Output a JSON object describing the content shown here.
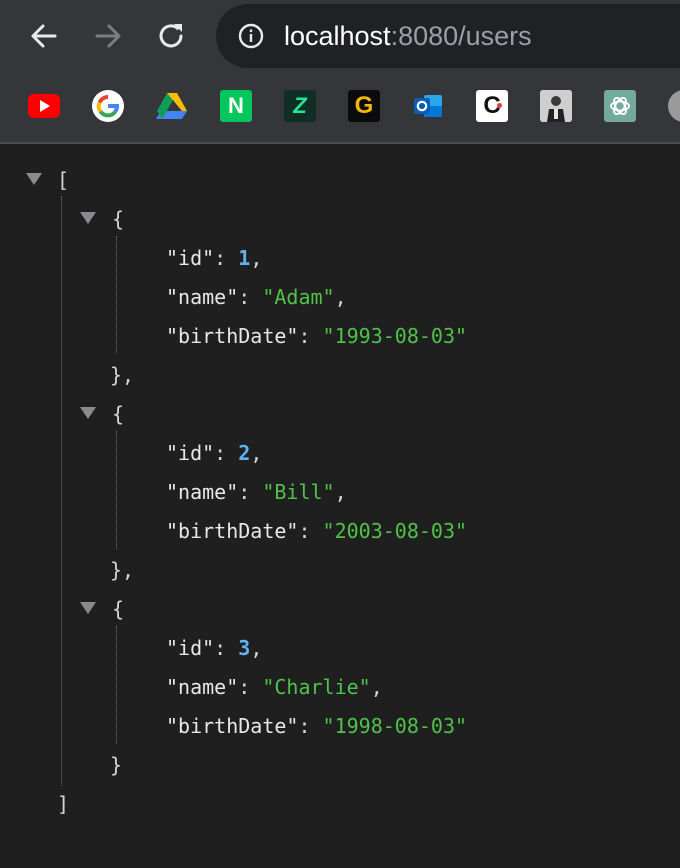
{
  "browser": {
    "address_bar": {
      "host": "localhost",
      "rest": ":8080/users"
    },
    "bookmarks": [
      {
        "icon": "youtube-icon"
      },
      {
        "icon": "google-icon"
      },
      {
        "icon": "google-drive-icon"
      },
      {
        "icon": "naver-icon",
        "letter": "N"
      },
      {
        "icon": "app-z-icon",
        "letter": "Z"
      },
      {
        "icon": "app-g-icon",
        "letter": "G"
      },
      {
        "icon": "outlook-icon",
        "letter": "O"
      },
      {
        "icon": "app-c-icon",
        "letter": "C"
      },
      {
        "icon": "profile-photo-icon"
      },
      {
        "icon": "chatgpt-icon"
      }
    ]
  },
  "json_viewer": {
    "open_bracket": "[",
    "close_bracket": "]",
    "open_brace": "{",
    "close_brace_comma": "},",
    "close_brace": "}",
    "keys": {
      "id": "\"id\"",
      "name": "\"name\"",
      "birth": "\"birthDate\""
    },
    "users": [
      {
        "id": "1",
        "name": "\"Adam\"",
        "birthDate": "\"1993-08-03\""
      },
      {
        "id": "2",
        "name": "\"Bill\"",
        "birthDate": "\"2003-08-03\""
      },
      {
        "id": "3",
        "name": "\"Charlie\"",
        "birthDate": "\"1998-08-03\""
      }
    ]
  },
  "colors": {
    "number": "#5fb3f0",
    "string": "#4fc24a",
    "background": "#1f1f1f"
  }
}
